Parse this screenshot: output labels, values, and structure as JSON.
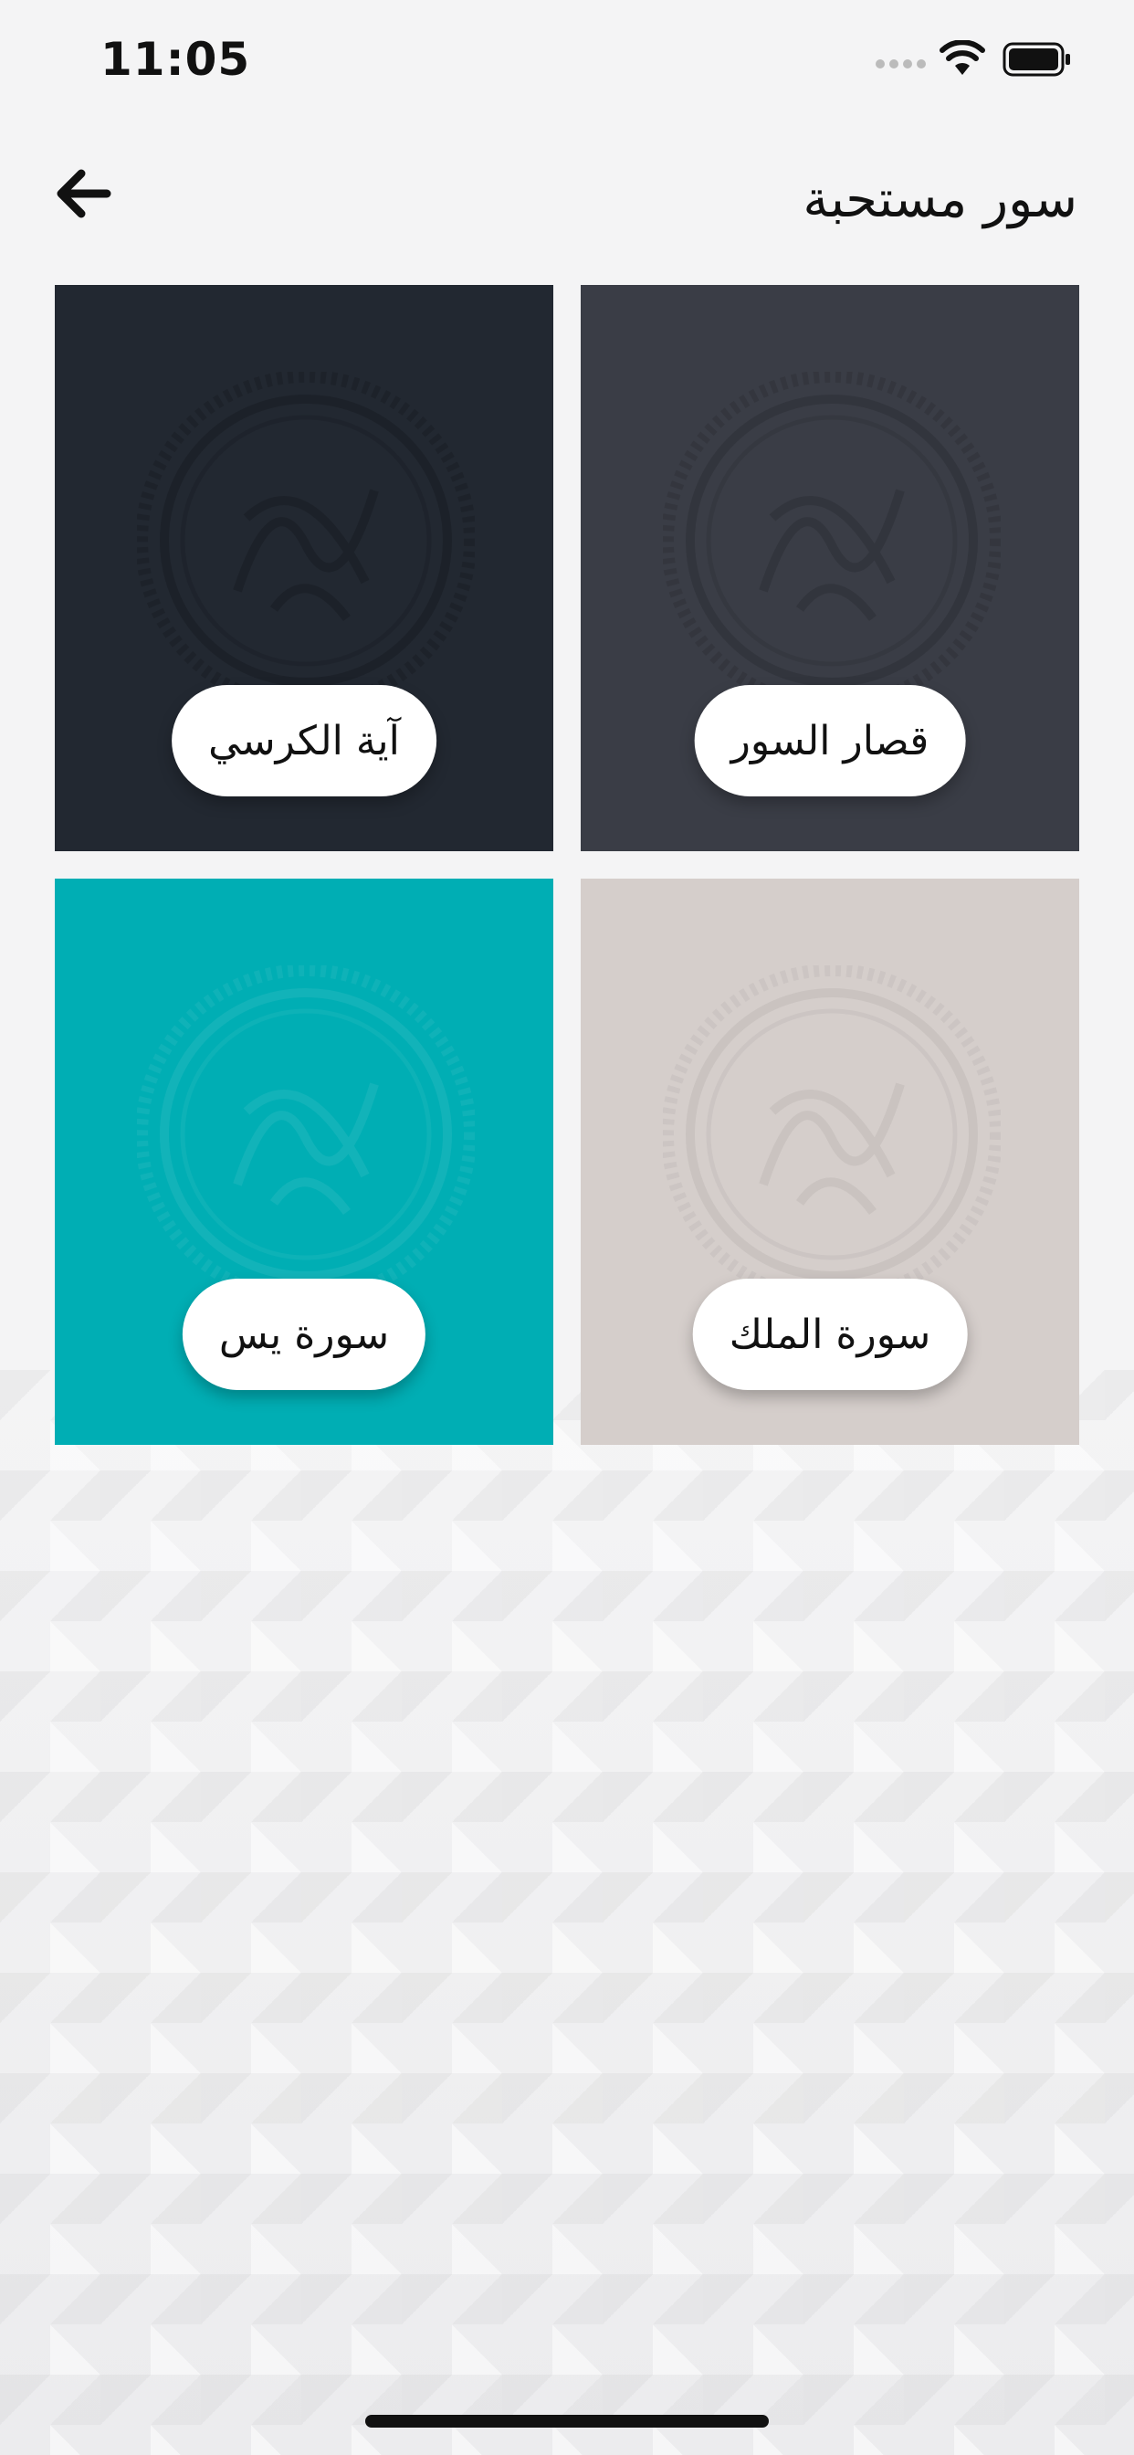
{
  "status_bar": {
    "time": "11:05",
    "icons": [
      "signal-icon",
      "wifi-icon",
      "battery-icon"
    ]
  },
  "header": {
    "title": "سور مستحبة",
    "back_icon": "arrow-left-icon"
  },
  "tiles": [
    {
      "label": "قصار السور",
      "color": "#3a3d46"
    },
    {
      "label": "آية الكرسي",
      "color": "#222831"
    },
    {
      "label": "سورة الملك",
      "color": "#d5cecb"
    },
    {
      "label": "سورة يس",
      "color": "#00aeb4"
    }
  ],
  "colors": {
    "background": "#f4f4f5",
    "pill": "#ffffff",
    "text": "#111111"
  }
}
